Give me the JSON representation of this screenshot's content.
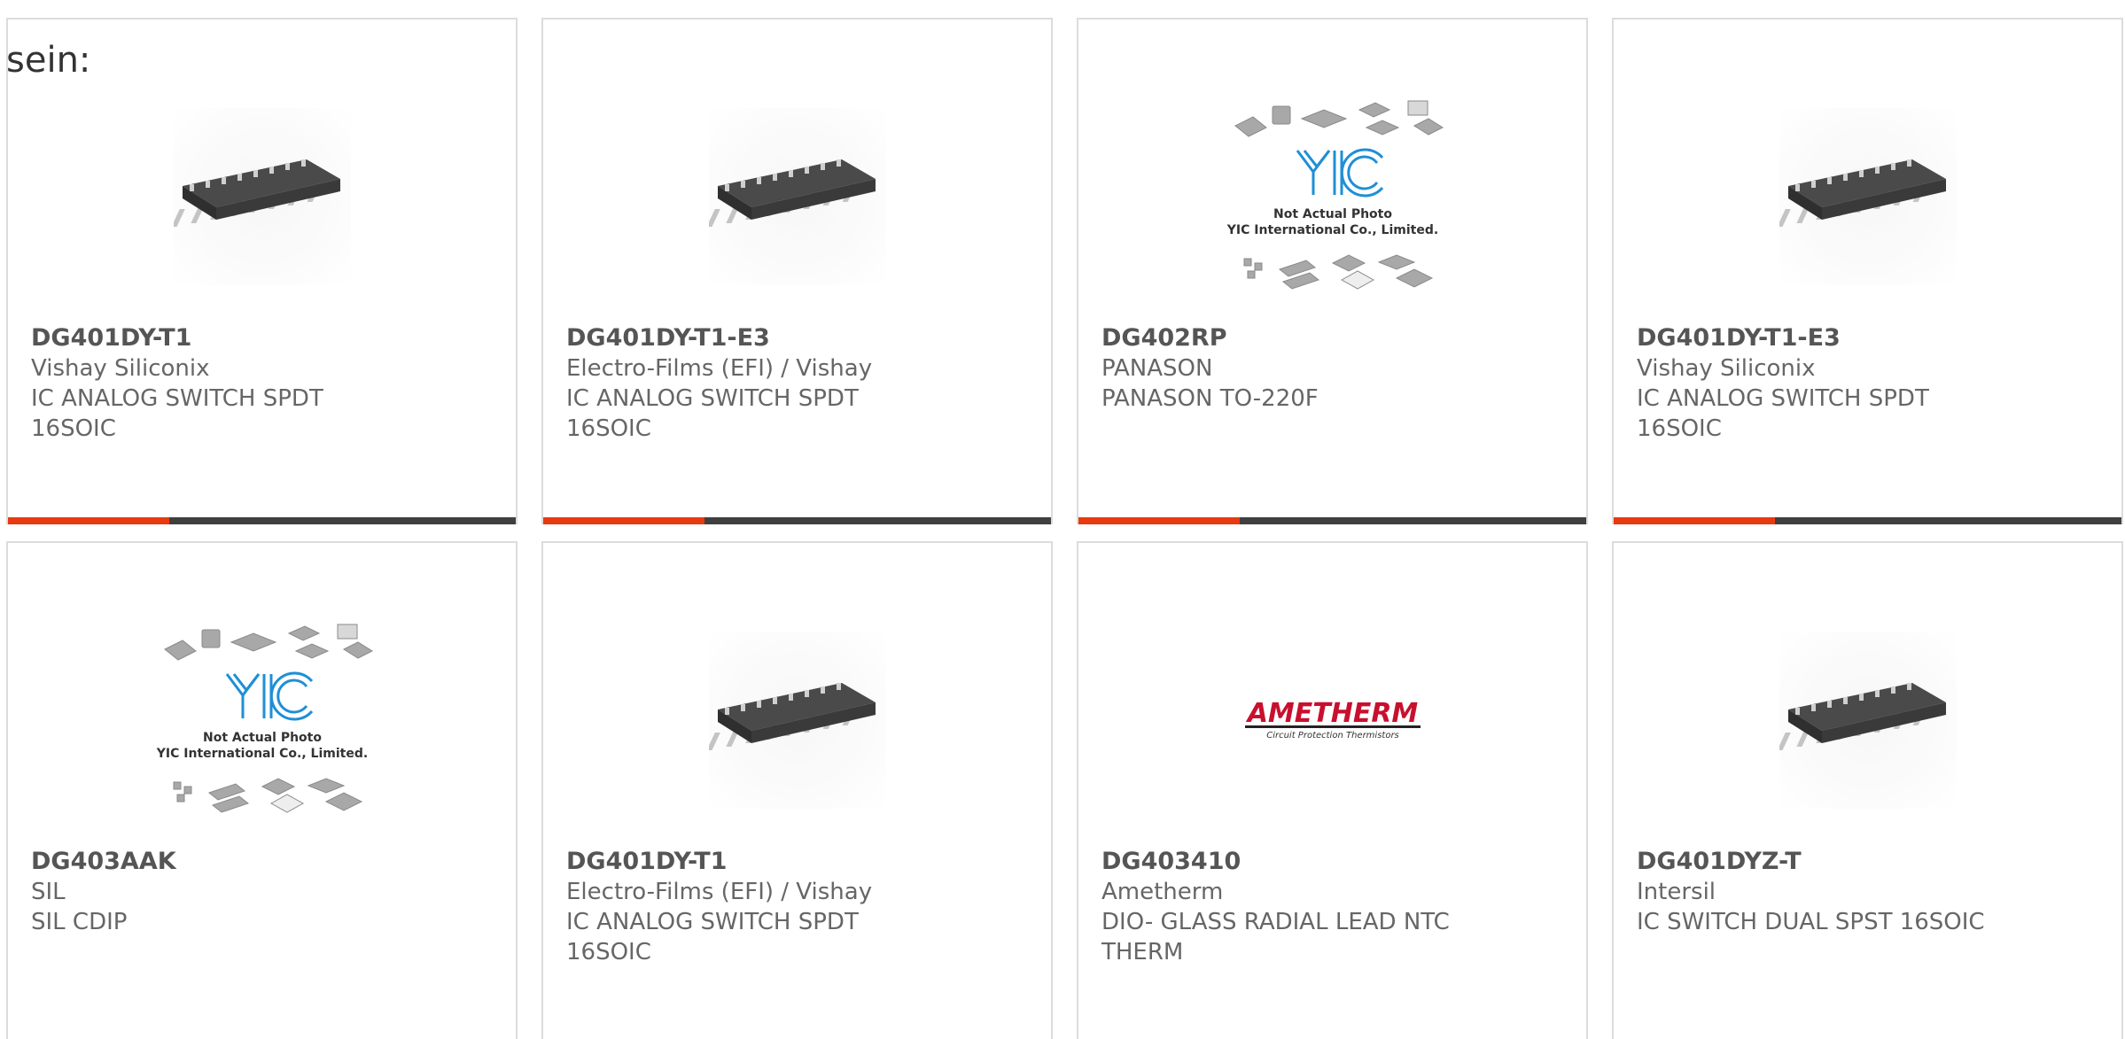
{
  "intro_text": "sein:",
  "placeholder_image": {
    "line1": "Not Actual Photo",
    "line2": "YIC International Co., Limited.",
    "logo_text": "YIC"
  },
  "brand_logo": {
    "name": "AMETHERM",
    "tagline": "Circuit Protection Thermistors"
  },
  "colors": {
    "accent": "#e83a10",
    "bar": "#3f3f3f",
    "border": "#dcdcdc",
    "text": "#666666",
    "logo_blue": "#1e8fd6",
    "ametherm_red": "#c8102e"
  },
  "products": [
    {
      "part": "DG401DY-T1",
      "manufacturer": "Vishay Siliconix",
      "desc1": "IC ANALOG SWITCH SPDT",
      "desc2": "16SOIC",
      "image": "soic16-chip"
    },
    {
      "part": "DG401DY-T1-E3",
      "manufacturer": "Electro-Films (EFI) / Vishay",
      "desc1": "IC ANALOG SWITCH SPDT",
      "desc2": "16SOIC",
      "image": "soic16-chip"
    },
    {
      "part": "DG402RP",
      "manufacturer": "PANASON",
      "desc1": "PANASON TO-220F",
      "desc2": "",
      "image": "yic-placeholder"
    },
    {
      "part": "DG401DY-T1-E3",
      "manufacturer": "Vishay Siliconix",
      "desc1": "IC ANALOG SWITCH SPDT",
      "desc2": "16SOIC",
      "image": "soic16-chip"
    },
    {
      "part": "DG403AAK",
      "manufacturer": "SIL",
      "desc1": "SIL CDIP",
      "desc2": "",
      "image": "yic-placeholder"
    },
    {
      "part": "DG401DY-T1",
      "manufacturer": "Electro-Films (EFI) / Vishay",
      "desc1": "IC ANALOG SWITCH SPDT",
      "desc2": "16SOIC",
      "image": "soic16-chip"
    },
    {
      "part": "DG403410",
      "manufacturer": "Ametherm",
      "desc1": "DIO- GLASS RADIAL LEAD NTC",
      "desc2": "THERM",
      "image": "ametherm-logo"
    },
    {
      "part": "DG401DYZ-T",
      "manufacturer": "Intersil",
      "desc1": "IC SWITCH DUAL SPST 16SOIC",
      "desc2": "",
      "image": "soic16-chip"
    }
  ]
}
